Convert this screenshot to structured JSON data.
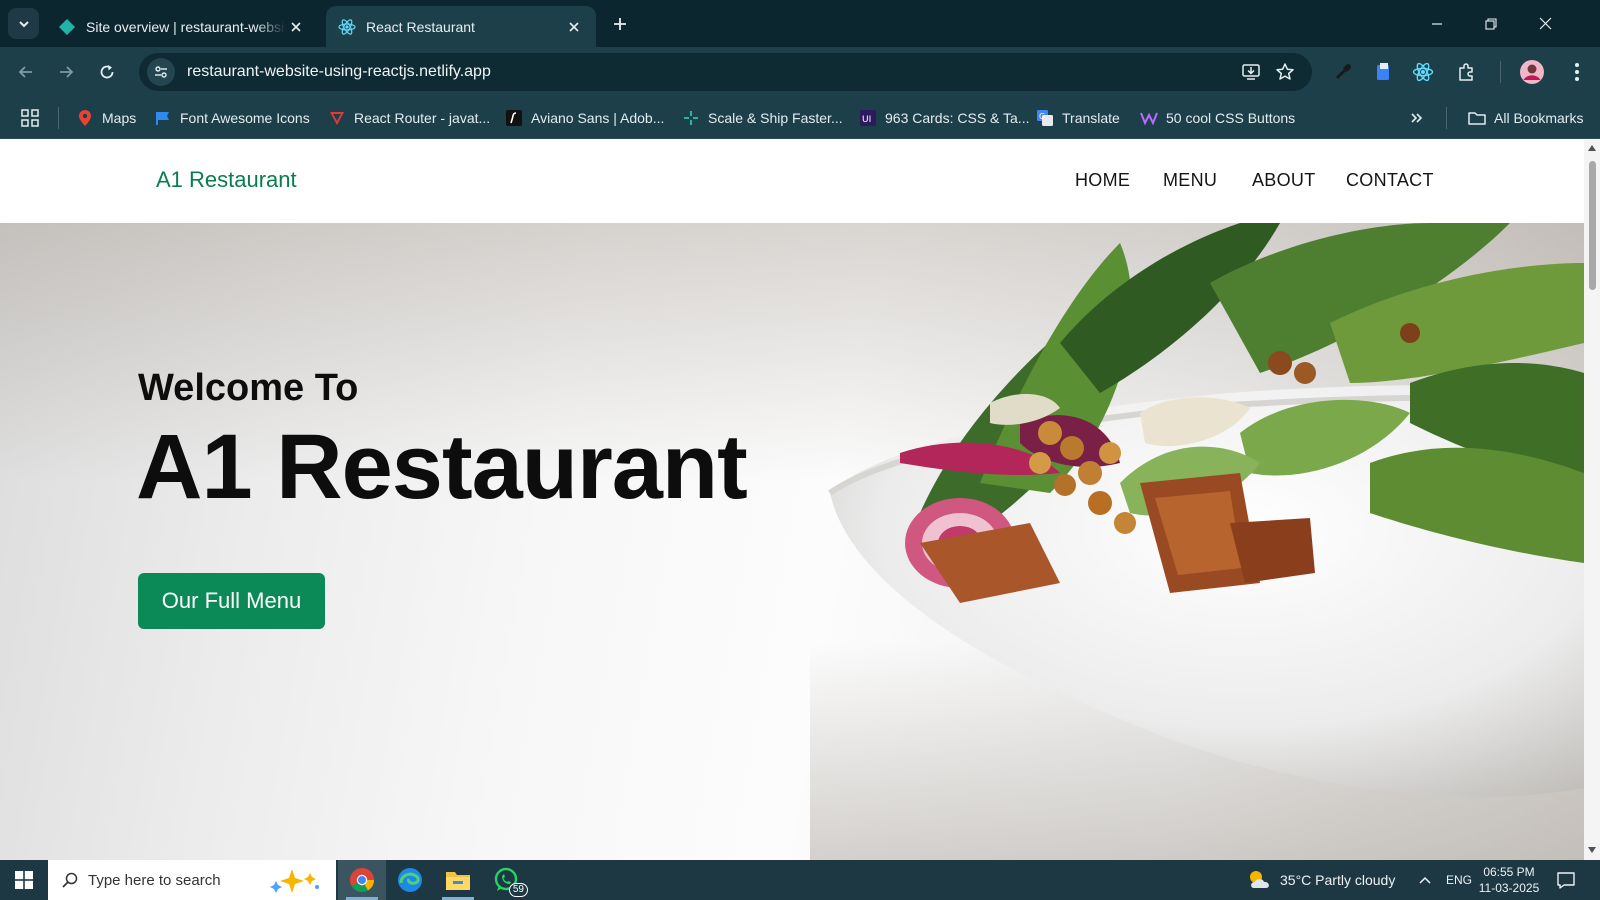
{
  "browser": {
    "tabs": [
      {
        "title": "Site overview | restaurant-website",
        "active": false
      },
      {
        "title": "React Restaurant",
        "active": true
      }
    ],
    "url": "restaurant-website-using-reactjs.netlify.app",
    "bookmarks": [
      {
        "label": "Maps"
      },
      {
        "label": "Font Awesome Icons"
      },
      {
        "label": "React Router - javat..."
      },
      {
        "label": "Aviano Sans | Adob..."
      },
      {
        "label": "Scale & Ship Faster..."
      },
      {
        "label": "963 Cards: CSS & Ta..."
      },
      {
        "label": "Translate"
      },
      {
        "label": "50 cool CSS Buttons"
      }
    ],
    "all_bookmarks_label": "All Bookmarks"
  },
  "site": {
    "brand": "A1 Restaurant",
    "nav": [
      "HOME",
      "MENU",
      "ABOUT",
      "CONTACT"
    ],
    "hero": {
      "welcome": "Welcome To",
      "title": "A1 Restaurant",
      "cta": "Our Full Menu"
    }
  },
  "taskbar": {
    "search_placeholder": "Type here to search",
    "whatsapp_badge": "59",
    "weather": "35°C  Partly cloudy",
    "language": "ENG",
    "time": "06:55 PM",
    "date": "11-03-2025"
  },
  "colors": {
    "brand_green": "#0a7c4f",
    "button_green": "#0b8a57",
    "chrome_dark": "#0c2630",
    "chrome_toolbar": "#1d3f4a"
  }
}
